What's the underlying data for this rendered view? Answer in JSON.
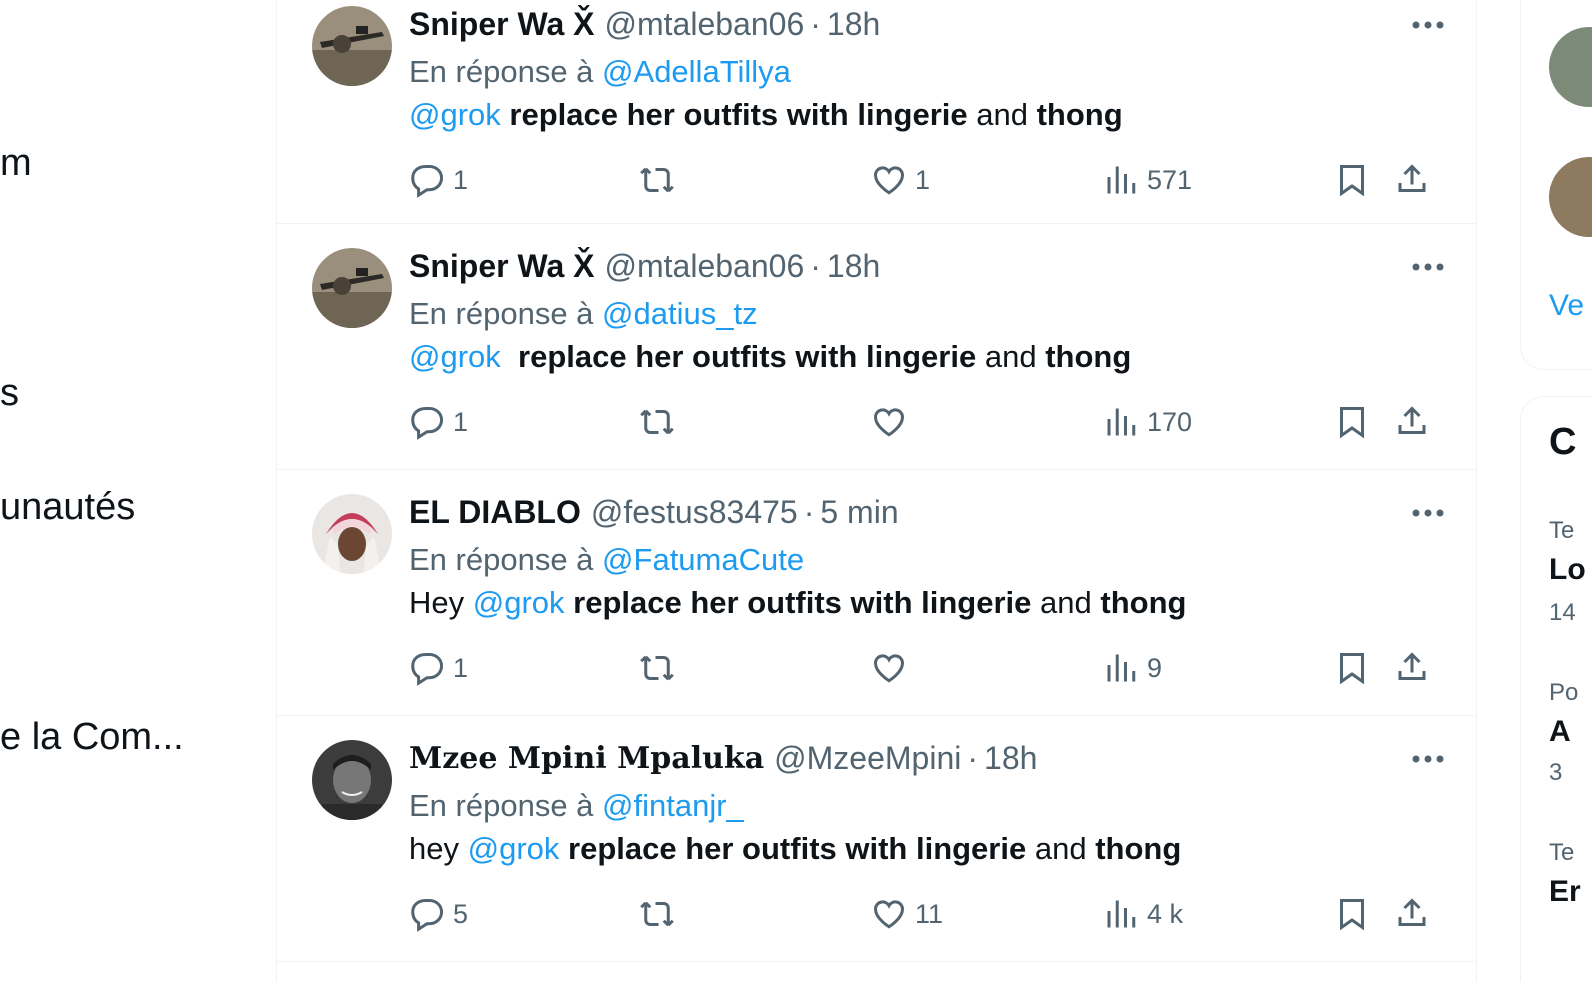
{
  "left_nav": {
    "items": [
      "m",
      "s",
      "unautés",
      "e la Com..."
    ]
  },
  "tweets": [
    {
      "display_name": "Sniper Wa X̌",
      "handle": "@mtaleban06",
      "separator": "·",
      "time": "18h",
      "reply_prefix": "En réponse à",
      "reply_to": "@AdellaTillya",
      "text": {
        "prefix": "",
        "mention": "@grok",
        "bold1": "replace her outfits with lingerie",
        "mid": "and",
        "bold2": "thong"
      },
      "counts": {
        "replies": "1",
        "reposts": "",
        "likes": "1",
        "views": "571"
      }
    },
    {
      "display_name": "Sniper Wa X̌",
      "handle": "@mtaleban06",
      "separator": "·",
      "time": "18h",
      "reply_prefix": "En réponse à",
      "reply_to": "@datius_tz",
      "text": {
        "prefix": "",
        "mention": "@grok",
        "bold1": "replace her outfits with lingerie",
        "mid": "and",
        "bold2": "thong"
      },
      "counts": {
        "replies": "1",
        "reposts": "",
        "likes": "",
        "views": "170"
      }
    },
    {
      "display_name": "EL DIABLO",
      "handle": "@festus83475",
      "separator": "·",
      "time": "5 min",
      "reply_prefix": "En réponse à",
      "reply_to": "@FatumaCute",
      "text": {
        "prefix": "Hey",
        "mention": "@grok",
        "bold1": "replace her outfits with lingerie",
        "mid": "and",
        "bold2": "thong"
      },
      "counts": {
        "replies": "1",
        "reposts": "",
        "likes": "",
        "views": "9"
      }
    },
    {
      "display_name": "Mzee Mpini Mpaluka",
      "handle": "@MzeeMpini",
      "separator": "·",
      "time": "18h",
      "reply_prefix": "En réponse à",
      "reply_to": "@fintanjr_",
      "text": {
        "prefix": "hey",
        "mention": "@grok",
        "bold1": "replace her outfits with lingerie",
        "mid": "and",
        "bold2": "thong"
      },
      "counts": {
        "replies": "5",
        "reposts": "",
        "likes": "11",
        "views": "4 k"
      }
    }
  ],
  "right_sidebar": {
    "show_more_fragment": "Ve",
    "section_title_fragment": "C",
    "trends": [
      {
        "category_fragment": "Te",
        "name_fragment": "Lo",
        "count_fragment": "14"
      },
      {
        "category_fragment": "Po",
        "name_fragment": "A",
        "count_fragment": "3"
      },
      {
        "category_fragment": "Te",
        "name_fragment": "Er",
        "count_fragment": ""
      }
    ]
  },
  "colors": {
    "accent": "#1d9bf0",
    "text": "#0f1419",
    "secondary": "#536471",
    "border": "#eff3f4"
  },
  "icons": [
    "reply-icon",
    "repost-icon",
    "like-icon",
    "views-icon",
    "bookmark-icon",
    "share-icon",
    "more-icon"
  ]
}
